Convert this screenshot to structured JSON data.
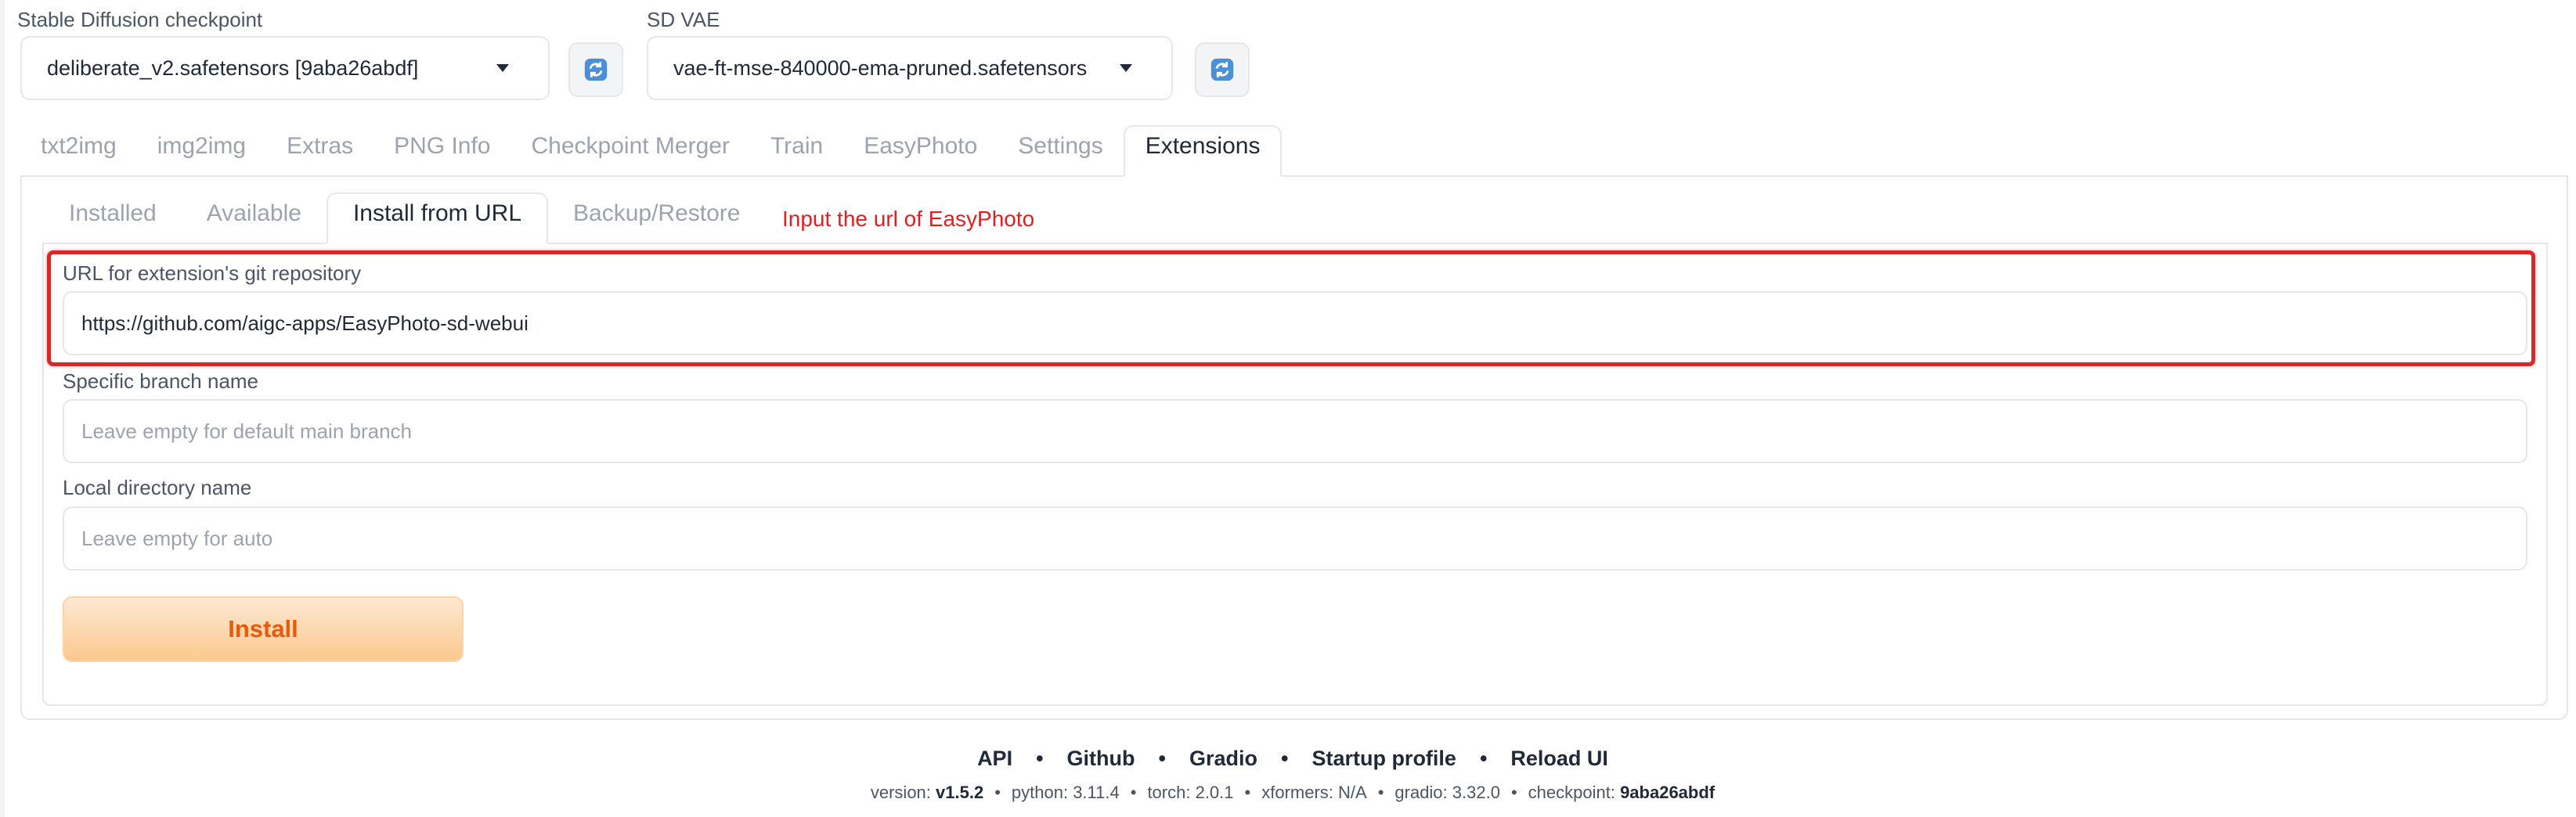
{
  "header": {
    "checkpoint_label": "Stable Diffusion checkpoint",
    "checkpoint_value": "deliberate_v2.safetensors [9aba26abdf]",
    "vae_label": "SD VAE",
    "vae_value": "vae-ft-mse-840000-ema-pruned.safetensors",
    "refresh_icon": "refresh-icon"
  },
  "main_tabs": [
    {
      "label": "txt2img",
      "active": false
    },
    {
      "label": "img2img",
      "active": false
    },
    {
      "label": "Extras",
      "active": false
    },
    {
      "label": "PNG Info",
      "active": false
    },
    {
      "label": "Checkpoint Merger",
      "active": false
    },
    {
      "label": "Train",
      "active": false
    },
    {
      "label": "EasyPhoto",
      "active": false
    },
    {
      "label": "Settings",
      "active": false
    },
    {
      "label": "Extensions",
      "active": true
    }
  ],
  "extension_tabs": [
    {
      "label": "Installed",
      "active": false
    },
    {
      "label": "Available",
      "active": false
    },
    {
      "label": "Install from URL",
      "active": true
    },
    {
      "label": "Backup/Restore",
      "active": false
    }
  ],
  "annotation": {
    "text": "Input the url of EasyPhoto",
    "color": "#e02020"
  },
  "form": {
    "url_label": "URL for extension's git repository",
    "url_value": "https://github.com/aigc-apps/EasyPhoto-sd-webui",
    "branch_label": "Specific branch name",
    "branch_placeholder": "Leave empty for default main branch",
    "dir_label": "Local directory name",
    "dir_placeholder": "Leave empty for auto",
    "install_label": "Install"
  },
  "footer": {
    "links": [
      "API",
      "Github",
      "Gradio",
      "Startup profile",
      "Reload UI"
    ],
    "separator": "•",
    "meta": {
      "version_label": "version:",
      "version": "v1.5.2",
      "python": "python: 3.11.4",
      "torch": "torch: 2.0.1",
      "xformers": "xformers: N/A",
      "gradio": "gradio: 3.32.0",
      "checkpoint_label": "checkpoint:",
      "checkpoint": "9aba26abdf"
    }
  },
  "colors": {
    "accent_orange": "#ea580c",
    "highlight_red": "#d62828"
  }
}
